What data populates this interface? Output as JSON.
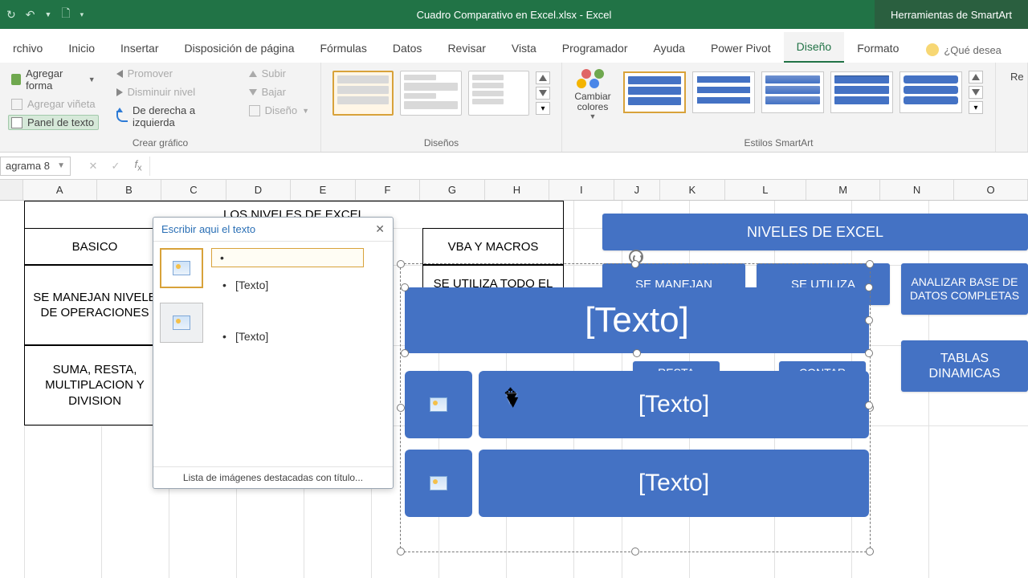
{
  "titlebar": {
    "doc": "Cuadro Comparativo en Excel.xlsx - Excel",
    "tooltab": "Herramientas de SmartArt"
  },
  "tabs": {
    "archivo": "rchivo",
    "inicio": "Inicio",
    "insertar": "Insertar",
    "disposicion": "Disposición de página",
    "formulas": "Fórmulas",
    "datos": "Datos",
    "revisar": "Revisar",
    "vista": "Vista",
    "programador": "Programador",
    "ayuda": "Ayuda",
    "powerpivot": "Power Pivot",
    "diseno": "Diseño",
    "formato": "Formato",
    "tellme": "¿Qué desea"
  },
  "ribbon": {
    "g1": {
      "agregar_forma": "Agregar forma",
      "agregar_vineta": "Agregar viñeta",
      "panel": "Panel de texto",
      "promover": "Promover",
      "disminuir": "Disminuir nivel",
      "rtl": "De derecha a izquierda",
      "subir": "Subir",
      "bajar": "Bajar",
      "diseno": "Diseño",
      "label": "Crear gráfico"
    },
    "g2": {
      "label": "Diseños"
    },
    "g3": {
      "cambiar": "Cambiar colores",
      "label": "Estilos SmartArt"
    },
    "g4": {
      "reset": "Re"
    }
  },
  "fbar": {
    "name": "agrama 8"
  },
  "cols": [
    "A",
    "B",
    "C",
    "D",
    "E",
    "F",
    "G",
    "H",
    "I",
    "J",
    "K",
    "L",
    "M",
    "N",
    "O"
  ],
  "cells": {
    "title": "LOS NIVELES DE EXCEL",
    "basico": "BASICO",
    "vba": "VBA Y MACROS",
    "seman": "SE MANEJAN NIVELE DE OPERACIONES",
    "seutil": "SE UTILIZA TODO EL",
    "suma": "SUMA, RESTA, MULTIPLACION Y DIVISION"
  },
  "textpane": {
    "title": "Escribir aqui el texto",
    "item": "[Texto]",
    "footer": "Lista de imágenes destacadas con título..."
  },
  "smartart_bg": {
    "root": "NIVELES DE EXCEL",
    "c1": "SE MANEJAN",
    "c2": "SE UTILIZA",
    "c3": "ANALIZAR BASE DE DATOS COMPLETAS",
    "c4": "TABLAS DINAMICAS",
    "resta": "RESTA",
    "contar": "CONTAR"
  },
  "smartart_sel": {
    "big": "[Texto]",
    "row1": "[Texto]",
    "row2": "[Texto]"
  }
}
